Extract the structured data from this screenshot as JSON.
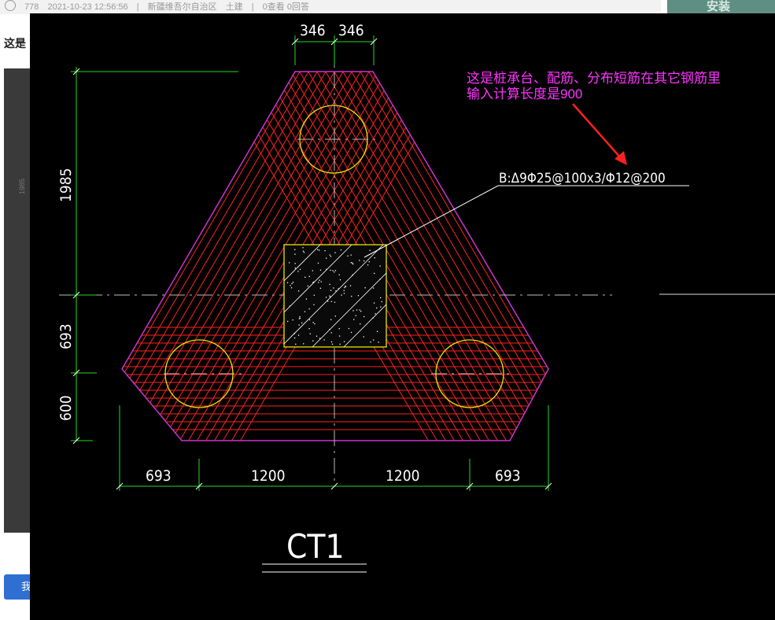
{
  "background_page": {
    "meta": {
      "views": "778",
      "datetime": "2021-10-23 12:56:56",
      "location": "新疆维吾尔自治区",
      "category": "土建",
      "stats": "0查看 0回答"
    },
    "title_fragment": "这是",
    "button_fragment": "我",
    "right_panel_text": "安装"
  },
  "cad": {
    "annotation_line1": "这是桩承台、配筋、分布短筋在其它钢筋里",
    "annotation_line2": "输入计算长度是900",
    "rebar_label": "B:Δ9Φ25@100x3/Φ12@200",
    "title": "CT1",
    "dims_top": [
      "346",
      "346"
    ],
    "dims_left": [
      "1985",
      "693",
      "600"
    ],
    "dims_bottom": [
      "693",
      "1200",
      "1200",
      "693"
    ],
    "colors": {
      "outline": "#cc33cc",
      "rebar": "#ff2222",
      "dimension": "#22dd22",
      "pile": "#e8e800",
      "column": "#e8e800"
    }
  }
}
